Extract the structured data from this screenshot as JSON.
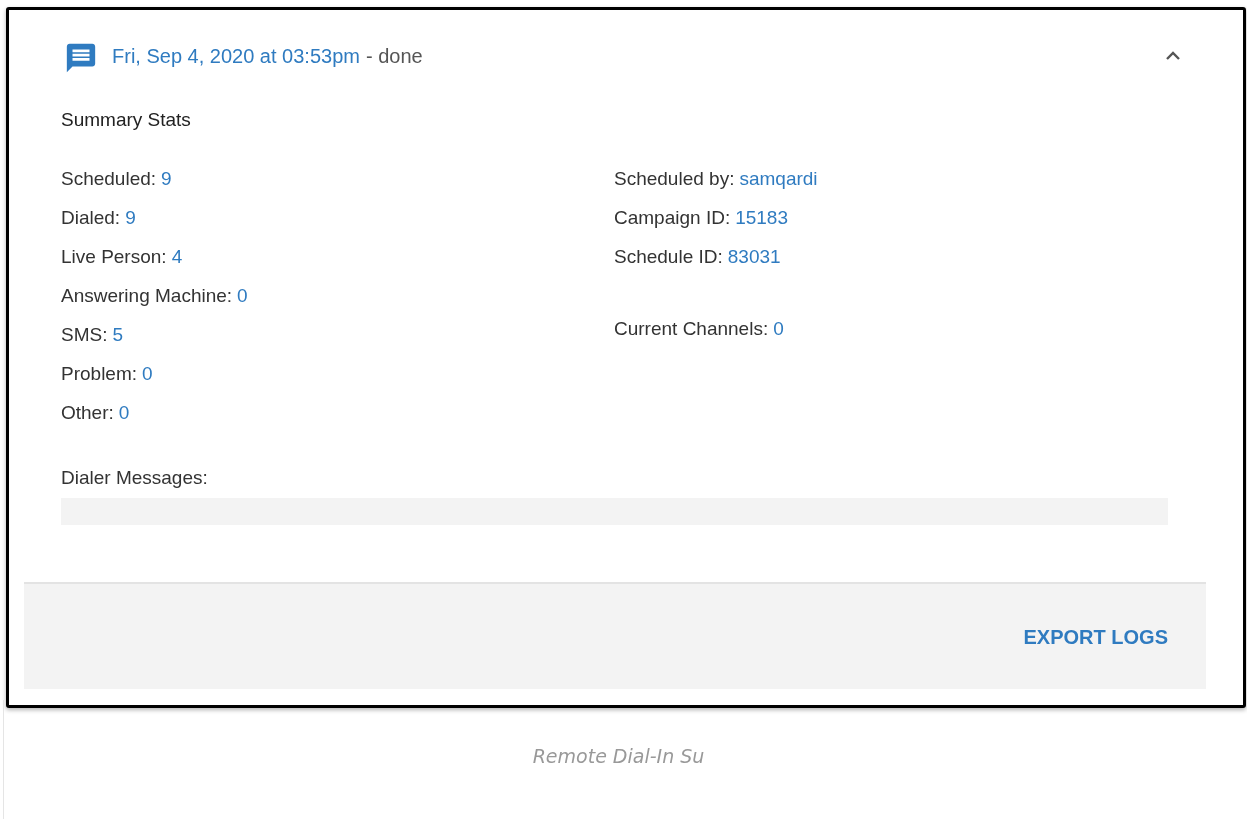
{
  "panel": {
    "title": "Fri, Sep 4, 2020 at 03:53pm",
    "status": "- done",
    "expanded": true,
    "section_title": "Summary Stats",
    "left_stats": [
      {
        "label": "Scheduled:",
        "value": "9"
      },
      {
        "label": "Dialed:",
        "value": "9"
      },
      {
        "label": "Live Person:",
        "value": "4"
      },
      {
        "label": "Answering Machine:",
        "value": "0"
      },
      {
        "label": "SMS:",
        "value": "5"
      },
      {
        "label": "Problem:",
        "value": "0"
      },
      {
        "label": "Other:",
        "value": "0"
      }
    ],
    "right_groups": [
      [
        {
          "label": "Scheduled by:",
          "value": "samqardi"
        },
        {
          "label": "Campaign ID:",
          "value": "15183"
        },
        {
          "label": "Schedule ID:",
          "value": "83031"
        }
      ],
      [
        {
          "label": "Current Channels:",
          "value": "0"
        }
      ]
    ],
    "messages_label": "Dialer Messages:",
    "export_button": "EXPORT LOGS"
  },
  "caption": "Remote Dial-In Su"
}
